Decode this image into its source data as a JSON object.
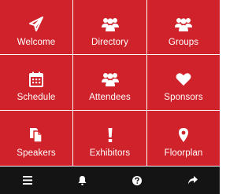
{
  "colors": {
    "tile_background": "#d0222a",
    "bottom_bar_background": "#141414",
    "icon_color": "#ffffff"
  },
  "tiles": [
    {
      "label": "Welcome",
      "icon": "paper-plane-icon"
    },
    {
      "label": "Directory",
      "icon": "people-group-icon"
    },
    {
      "label": "Groups",
      "icon": "people-group-icon"
    },
    {
      "label": "Schedule",
      "icon": "calendar-icon"
    },
    {
      "label": "Attendees",
      "icon": "people-group-icon"
    },
    {
      "label": "Sponsors",
      "icon": "heart-icon"
    },
    {
      "label": "Speakers",
      "icon": "documents-icon"
    },
    {
      "label": "Exhibitors",
      "icon": "exclamation-icon"
    },
    {
      "label": "Floorplan",
      "icon": "map-pin-icon"
    }
  ],
  "bottom_bar": [
    {
      "icon": "hamburger-menu-icon"
    },
    {
      "icon": "bell-icon"
    },
    {
      "icon": "help-circle-icon"
    },
    {
      "icon": "share-arrow-icon"
    }
  ]
}
